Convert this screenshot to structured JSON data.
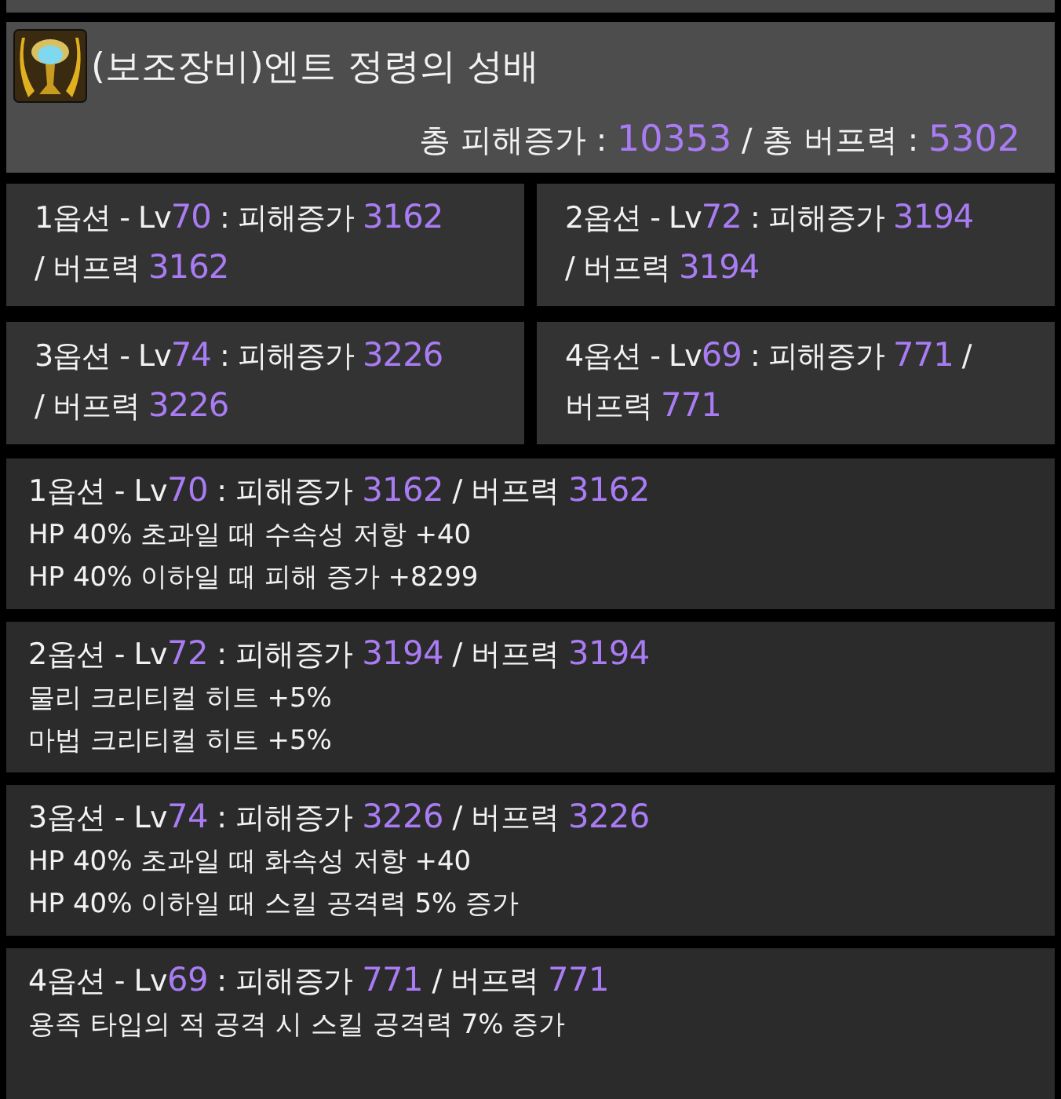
{
  "item": {
    "name": "(보조장비)엔트 정령의 성배",
    "totals": [
      {
        "text": "총 피해증가 : ",
        "accent": false
      },
      {
        "text": "10353",
        "accent": true
      },
      {
        "text": " / 총 버프력 : ",
        "accent": false
      },
      {
        "text": "5302",
        "accent": true
      }
    ]
  },
  "summaries": [
    {
      "lines": [
        [
          {
            "text": "1옵션 - Lv",
            "accent": false
          },
          {
            "text": "70",
            "accent": true
          },
          {
            "text": " : 피해증가 ",
            "accent": false
          },
          {
            "text": "3162",
            "accent": true
          }
        ],
        [
          {
            "text": "/ 버프력 ",
            "accent": false
          },
          {
            "text": "3162",
            "accent": true
          }
        ]
      ]
    },
    {
      "lines": [
        [
          {
            "text": "2옵션 - Lv",
            "accent": false
          },
          {
            "text": "72",
            "accent": true
          },
          {
            "text": " : 피해증가 ",
            "accent": false
          },
          {
            "text": "3194",
            "accent": true
          }
        ],
        [
          {
            "text": "/ 버프력 ",
            "accent": false
          },
          {
            "text": "3194",
            "accent": true
          }
        ]
      ]
    },
    {
      "lines": [
        [
          {
            "text": "3옵션 - Lv",
            "accent": false
          },
          {
            "text": "74",
            "accent": true
          },
          {
            "text": " : 피해증가 ",
            "accent": false
          },
          {
            "text": "3226",
            "accent": true
          }
        ],
        [
          {
            "text": "/ 버프력 ",
            "accent": false
          },
          {
            "text": "3226",
            "accent": true
          }
        ]
      ]
    },
    {
      "lines": [
        [
          {
            "text": "4옵션 - Lv",
            "accent": false
          },
          {
            "text": "69",
            "accent": true
          },
          {
            "text": " : 피해증가 ",
            "accent": false
          },
          {
            "text": "771",
            "accent": true
          },
          {
            "text": " /",
            "accent": false
          }
        ],
        [
          {
            "text": "버프력 ",
            "accent": false
          },
          {
            "text": "771",
            "accent": true
          }
        ]
      ]
    }
  ],
  "details": [
    {
      "heading": [
        {
          "text": "1옵션 - Lv",
          "accent": false
        },
        {
          "text": "70",
          "accent": true
        },
        {
          "text": " : 피해증가 ",
          "accent": false
        },
        {
          "text": "3162",
          "accent": true
        },
        {
          "text": " / 버프력 ",
          "accent": false
        },
        {
          "text": "3162",
          "accent": true
        }
      ],
      "effects": [
        "HP 40% 초과일 때 수속성 저항 +40",
        "HP 40% 이하일 때 피해 증가 +8299"
      ]
    },
    {
      "heading": [
        {
          "text": "2옵션 - Lv",
          "accent": false
        },
        {
          "text": "72",
          "accent": true
        },
        {
          "text": " : 피해증가 ",
          "accent": false
        },
        {
          "text": "3194",
          "accent": true
        },
        {
          "text": " / 버프력 ",
          "accent": false
        },
        {
          "text": "3194",
          "accent": true
        }
      ],
      "effects": [
        "물리 크리티컬 히트 +5%",
        "마법 크리티컬 히트 +5%"
      ]
    },
    {
      "heading": [
        {
          "text": "3옵션 - Lv",
          "accent": false
        },
        {
          "text": "74",
          "accent": true
        },
        {
          "text": " : 피해증가 ",
          "accent": false
        },
        {
          "text": "3226",
          "accent": true
        },
        {
          "text": " / 버프력 ",
          "accent": false
        },
        {
          "text": "3226",
          "accent": true
        }
      ],
      "effects": [
        "HP 40% 초과일 때 화속성 저항 +40",
        "HP 40% 이하일 때 스킬 공격력 5% 증가"
      ]
    },
    {
      "heading": [
        {
          "text": "4옵션 - Lv",
          "accent": false
        },
        {
          "text": "69",
          "accent": true
        },
        {
          "text": " : 피해증가 ",
          "accent": false
        },
        {
          "text": "771",
          "accent": true
        },
        {
          "text": " / 버프력 ",
          "accent": false
        },
        {
          "text": "771",
          "accent": true
        }
      ],
      "effects": [
        "용족 타입의 적 공격 시 스킬 공격력 7% 증가"
      ]
    }
  ]
}
